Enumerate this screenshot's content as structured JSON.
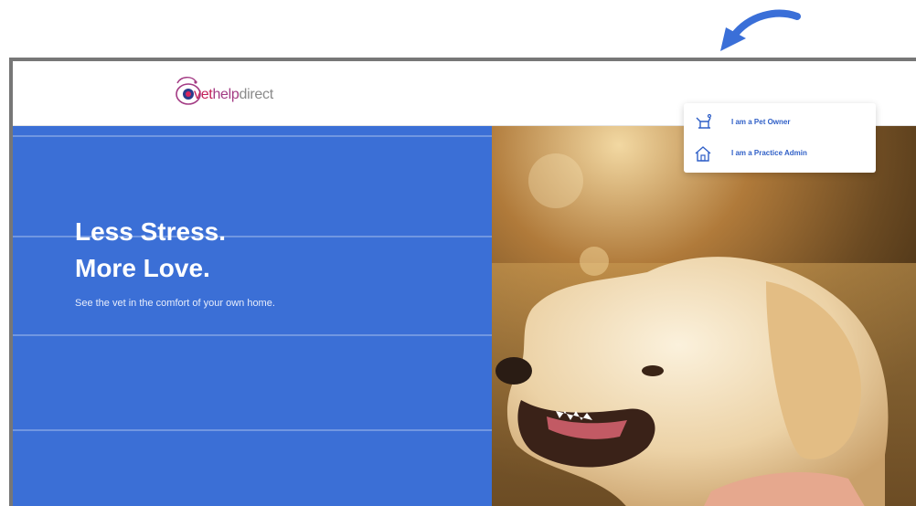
{
  "logo": {
    "vet": "vet",
    "help": "help",
    "direct": "direct",
    "subtitle": ""
  },
  "nav": {
    "signup_label": "",
    "login_label": ""
  },
  "dropdown": {
    "items": [
      {
        "label": "I am a Pet Owner",
        "icon": "pet-owner-icon"
      },
      {
        "label": "I am a Practice Admin",
        "icon": "home-icon"
      }
    ]
  },
  "hero": {
    "title_line1": "Less Stress.",
    "title_line2": "More Love.",
    "subtitle": "See the vet in the comfort of your own home."
  },
  "colors": {
    "hero_blue": "#3b6fd6",
    "dropdown_text": "#2f5fc7",
    "annotation_arrow": "#3a6fd8",
    "brand_pink": "#c4215a"
  }
}
